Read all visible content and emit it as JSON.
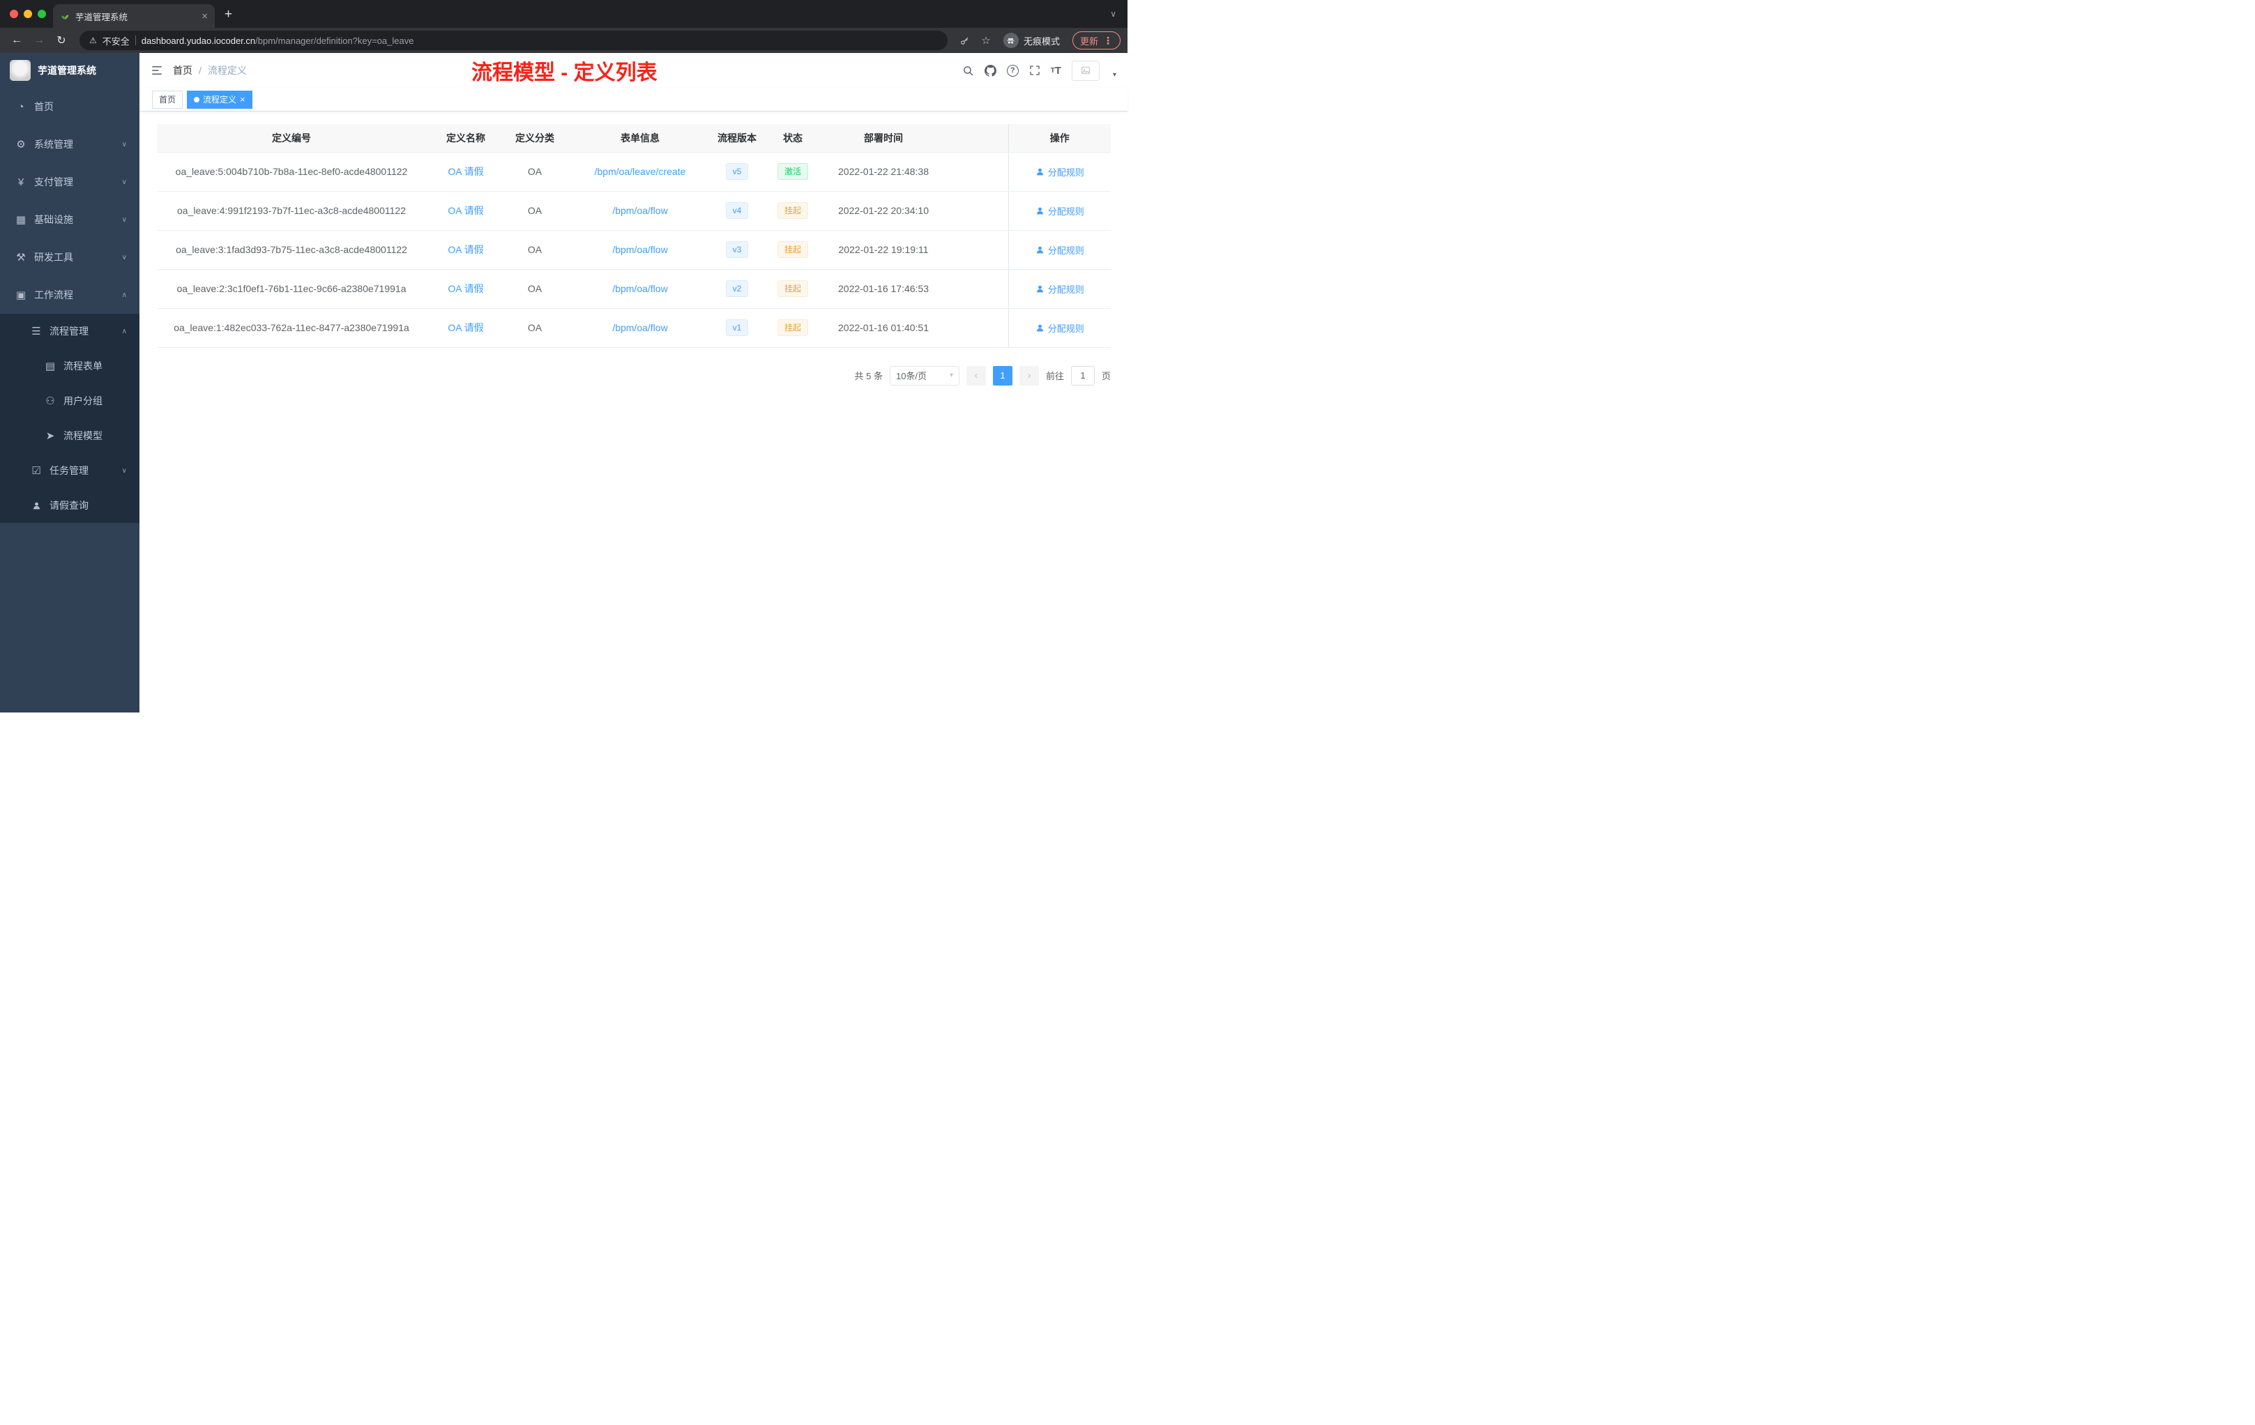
{
  "colors": {
    "accent": "#409eff",
    "success": "#13ce66",
    "warning": "#e6a23c",
    "annotation_red": "#f5241a",
    "sidebar_bg": "#304156",
    "submenu_bg": "#1f2d3d"
  },
  "browser": {
    "tab_title": "芋道管理系统",
    "security_label": "不安全",
    "url_domain": "dashboard.yudao.iocoder.cn",
    "url_path": "/bpm/manager/definition?key=oa_leave",
    "incognito_label": "无痕模式",
    "update_label": "更新"
  },
  "sidebar": {
    "logo_title": "芋道管理系统",
    "items": [
      {
        "label": "首页",
        "icon": "dashboard-icon"
      },
      {
        "label": "系统管理",
        "icon": "gear-icon"
      },
      {
        "label": "支付管理",
        "icon": "yen-icon"
      },
      {
        "label": "基础设施",
        "icon": "infrastructure-icon"
      },
      {
        "label": "研发工具",
        "icon": "tools-icon"
      },
      {
        "label": "工作流程",
        "icon": "briefcase-icon"
      },
      {
        "label": "流程管理",
        "icon": "list-icon"
      },
      {
        "label": "流程表单",
        "icon": "document-icon"
      },
      {
        "label": "用户分组",
        "icon": "users-icon"
      },
      {
        "label": "流程模型",
        "icon": "paper-plane-icon"
      },
      {
        "label": "任务管理",
        "icon": "task-icon"
      },
      {
        "label": "请假查询",
        "icon": "person-icon"
      }
    ]
  },
  "header": {
    "breadcrumb_home": "首页",
    "breadcrumb_sep": "/",
    "breadcrumb_current": "流程定义",
    "annotation": "流程模型 - 定义列表"
  },
  "tags": {
    "home": "首页",
    "active": "流程定义"
  },
  "table": {
    "columns": [
      "定义编号",
      "定义名称",
      "定义分类",
      "表单信息",
      "流程版本",
      "状态",
      "部署时间",
      "操作"
    ],
    "rows": [
      {
        "id": "oa_leave:5:004b710b-7b8a-11ec-8ef0-acde48001122",
        "name": "OA 请假",
        "category": "OA",
        "form": "/bpm/oa/leave/create",
        "version": "v5",
        "status": "激活",
        "status_type": "success",
        "time": "2022-01-22 21:48:38",
        "action": "分配规则"
      },
      {
        "id": "oa_leave:4:991f2193-7b7f-11ec-a3c8-acde48001122",
        "name": "OA 请假",
        "category": "OA",
        "form": "/bpm/oa/flow",
        "version": "v4",
        "status": "挂起",
        "status_type": "warning",
        "time": "2022-01-22 20:34:10",
        "action": "分配规则"
      },
      {
        "id": "oa_leave:3:1fad3d93-7b75-11ec-a3c8-acde48001122",
        "name": "OA 请假",
        "category": "OA",
        "form": "/bpm/oa/flow",
        "version": "v3",
        "status": "挂起",
        "status_type": "warning",
        "time": "2022-01-22 19:19:11",
        "action": "分配规则"
      },
      {
        "id": "oa_leave:2:3c1f0ef1-76b1-11ec-9c66-a2380e71991a",
        "name": "OA 请假",
        "category": "OA",
        "form": "/bpm/oa/flow",
        "version": "v2",
        "status": "挂起",
        "status_type": "warning",
        "time": "2022-01-16 17:46:53",
        "action": "分配规则"
      },
      {
        "id": "oa_leave:1:482ec033-762a-11ec-8477-a2380e71991a",
        "name": "OA 请假",
        "category": "OA",
        "form": "/bpm/oa/flow",
        "version": "v1",
        "status": "挂起",
        "status_type": "warning",
        "time": "2022-01-16 01:40:51",
        "action": "分配规则"
      }
    ]
  },
  "pagination": {
    "total": "共 5 条",
    "size": "10条/页",
    "page": "1",
    "goto": "前往",
    "goto_value": "1",
    "unit": "页"
  }
}
